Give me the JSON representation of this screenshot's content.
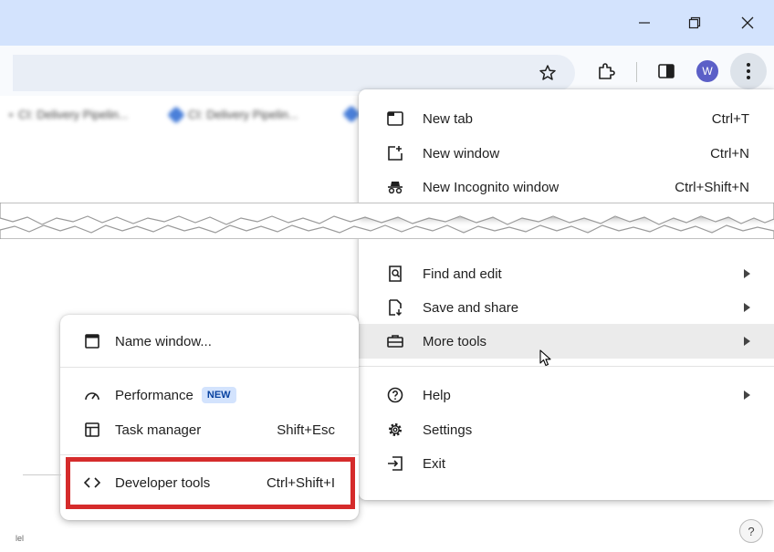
{
  "window": {
    "minimize_icon": "minimize-icon",
    "restore_icon": "restore-icon",
    "close_icon": "close-icon"
  },
  "toolbar": {
    "avatar_letter": "W"
  },
  "bookmarks": [
    "CI: Delivery Pipelin...",
    "CI: Delivery Pipelin..."
  ],
  "main_menu": {
    "top_items": [
      {
        "label": "New tab",
        "shortcut": "Ctrl+T",
        "icon": "new-tab-icon"
      },
      {
        "label": "New window",
        "shortcut": "Ctrl+N",
        "icon": "new-window-icon"
      },
      {
        "label": "New Incognito window",
        "shortcut": "Ctrl+Shift+N",
        "icon": "incognito-icon"
      }
    ],
    "bottom_items": [
      {
        "label": "Find and edit",
        "icon": "find-edit-icon"
      },
      {
        "label": "Save and share",
        "icon": "save-share-icon"
      },
      {
        "label": "More tools",
        "icon": "toolbox-icon",
        "highlighted": true
      },
      {
        "label": "Help",
        "icon": "help-icon"
      },
      {
        "label": "Settings",
        "icon": "settings-icon"
      },
      {
        "label": "Exit",
        "icon": "exit-icon"
      }
    ]
  },
  "sub_menu": {
    "name_window": {
      "label": "Name window...",
      "icon": "window-icon"
    },
    "performance": {
      "label": "Performance",
      "badge": "NEW",
      "icon": "performance-icon"
    },
    "task_manager": {
      "label": "Task manager",
      "shortcut": "Shift+Esc",
      "icon": "task-manager-icon"
    },
    "developer_tools": {
      "label": "Developer tools",
      "shortcut": "Ctrl+Shift+I",
      "icon": "code-icon"
    }
  },
  "colors": {
    "highlight_box": "#d52b2b",
    "titlebar": "#d3e3fd",
    "badge_bg": "#d3e3fd"
  },
  "help_button": "?",
  "bg_fragment": "lel"
}
